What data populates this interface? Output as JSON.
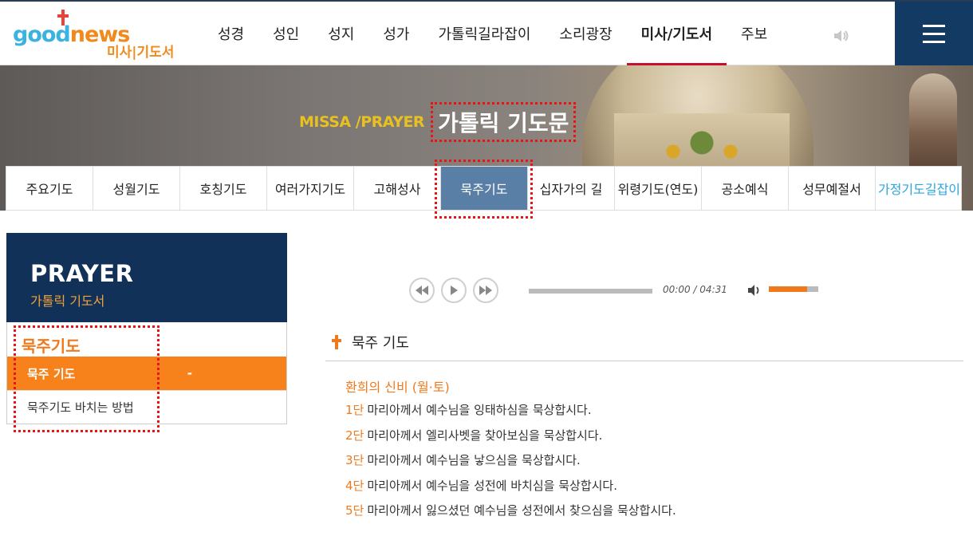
{
  "logo": {
    "word_part1": "good",
    "word_part2": "news",
    "subtitle": "미사|기도서"
  },
  "gnb": {
    "items": [
      {
        "label": "성경"
      },
      {
        "label": "성인"
      },
      {
        "label": "성지"
      },
      {
        "label": "성가"
      },
      {
        "label": "가톨릭길라잡이"
      },
      {
        "label": "소리광장"
      },
      {
        "label": "미사/기도서",
        "active": true
      },
      {
        "label": "주보"
      }
    ],
    "speaker_icon": "speaker-icon",
    "menu_icon": "hamburger-menu-icon"
  },
  "banner": {
    "en_label": "MISSA /PRAYER",
    "ko_title": "가톨릭 기도문"
  },
  "subtabs": [
    {
      "label": "주요기도"
    },
    {
      "label": "성월기도"
    },
    {
      "label": "호칭기도"
    },
    {
      "label": "여러가지기도"
    },
    {
      "label": "고해성사"
    },
    {
      "label": "묵주기도",
      "active": true
    },
    {
      "label": "십자가의 길"
    },
    {
      "label": "위령기도(연도)"
    },
    {
      "label": "공소예식"
    },
    {
      "label": "성무예절서"
    },
    {
      "label": "가정기도길잡이",
      "highlight": true
    }
  ],
  "sidebar": {
    "title": "PRAYER",
    "subtitle": "가톨릭 기도서",
    "category": "묵주기도",
    "items": [
      {
        "label": "묵주 기도",
        "marker": "-",
        "active": true
      },
      {
        "label": "묵주기도 바치는 방법",
        "marker": ""
      }
    ]
  },
  "player": {
    "current_time": "00:00",
    "separator": "/",
    "total_time": "04:31",
    "progress": 0,
    "volume": 0.77
  },
  "content": {
    "title": "묵주 기도",
    "mystery_title": "환희의 신비 (월·토)",
    "decades": [
      {
        "num": "1단",
        "text": "마리아께서 예수님을 잉태하심을 묵상합시다."
      },
      {
        "num": "2단",
        "text": "마리아께서 엘리사벳을 찾아보심을 묵상합시다."
      },
      {
        "num": "3단",
        "text": "마리아께서 예수님을 낳으심을 묵상합시다."
      },
      {
        "num": "4단",
        "text": "마리아께서 예수님을 성전에 바치심을 묵상합시다."
      },
      {
        "num": "5단",
        "text": "마리아께서 잃으셨던 예수님을 성전에서 찾으심을 묵상합시다."
      }
    ]
  },
  "colors": {
    "navy": "#123158",
    "orange": "#f07a1b",
    "tab_active": "#5a7fa6",
    "gold": "#e9c021"
  }
}
